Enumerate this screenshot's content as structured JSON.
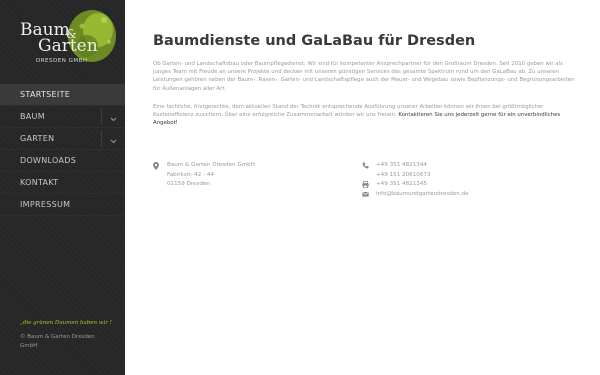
{
  "logo": {
    "word1": "Baum",
    "ampersand": "&",
    "word2": "Garten",
    "subtitle": "DRESDEN GMBH"
  },
  "nav": {
    "items": [
      {
        "label": "STARTSEITE",
        "active": true
      },
      {
        "label": "BAUM",
        "has_submenu": true
      },
      {
        "label": "GARTEN",
        "has_submenu": true
      },
      {
        "label": "DOWNLOADS"
      },
      {
        "label": "KONTAKT"
      },
      {
        "label": "IMPRESSUM"
      }
    ]
  },
  "sidebar": {
    "slogan": "„die grünen Daumen haben wir !",
    "copyright": "© Baum & Garten Dresden GmbH"
  },
  "main": {
    "title": "Baumdienste und GaLaBau für Dresden",
    "intro": "Ob Garten- und Landschaftsbau oder Baumpflegedienst: Wir sind für kompetenter Ansprechpartner für den Großraum Dresden. Seit 2010 geben wir als junges Team mit Freude an unsere Projekte und decken mit unseren günstigen Services das gesamte Spektrum rund um den GaLaBau ab. Zu unseren Leistungen gehören neben der Baum-, Rasen-, Garten- und Landschaftspflege auch der Mauer- und Wegebau sowie Bepflanzungs- und Begrünungsarbeiten für Außenanlagen aller Art.",
    "intro2": "Eine fachliche, fristgerechte, dem aktuellen Stand der Technik entsprechende Ausführung unserer Arbeiten können wir Ihnen bei größtmöglicher Kosteneffizienz zusichern. Über eine erfolgreiche Zusammenarbeit würden wir uns freuen.",
    "intro2_link": "Kontaktieren Sie uns jederzeit gerne für ein unverbindliches Angebot!"
  },
  "address": {
    "company": "Baum & Garten Dresden GmbH",
    "street": "Fabrikstr. 42 - 44",
    "city": "01159 Dresden"
  },
  "contact": {
    "phone": "+49 351 4821344",
    "mobile": "+49 151 20610673",
    "fax": "+49 351 4821345",
    "email": "info@baumundgartendresden.de"
  },
  "colors": {
    "sidebar_bg": "#262626",
    "accent_green": "#9fca34",
    "title_text": "#3a3a3a",
    "body_text": "#9a9a9a"
  }
}
